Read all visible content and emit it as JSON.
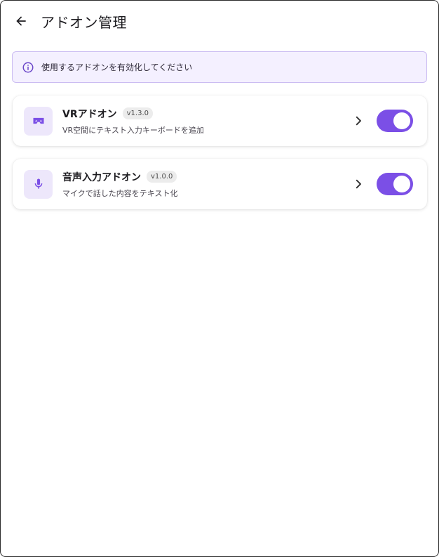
{
  "header": {
    "title": "アドオン管理",
    "back_icon": "arrow-left-icon"
  },
  "info": {
    "text": "使用するアドオンを有効化してください",
    "icon": "info-icon"
  },
  "addons": [
    {
      "name": "VRアドオン",
      "version": "v1.3.0",
      "description": "VR空間にテキスト入力キーボードを追加",
      "icon": "vr-headset-icon",
      "enabled": true
    },
    {
      "name": "音声入力アドオン",
      "version": "v1.0.0",
      "description": "マイクで話した内容をテキスト化",
      "icon": "microphone-icon",
      "enabled": true
    }
  ],
  "colors": {
    "accent": "#7b4fe6",
    "icon_bg": "#ede7fb",
    "banner_bg": "#f4f0ff",
    "banner_border": "#cbbcf2"
  }
}
